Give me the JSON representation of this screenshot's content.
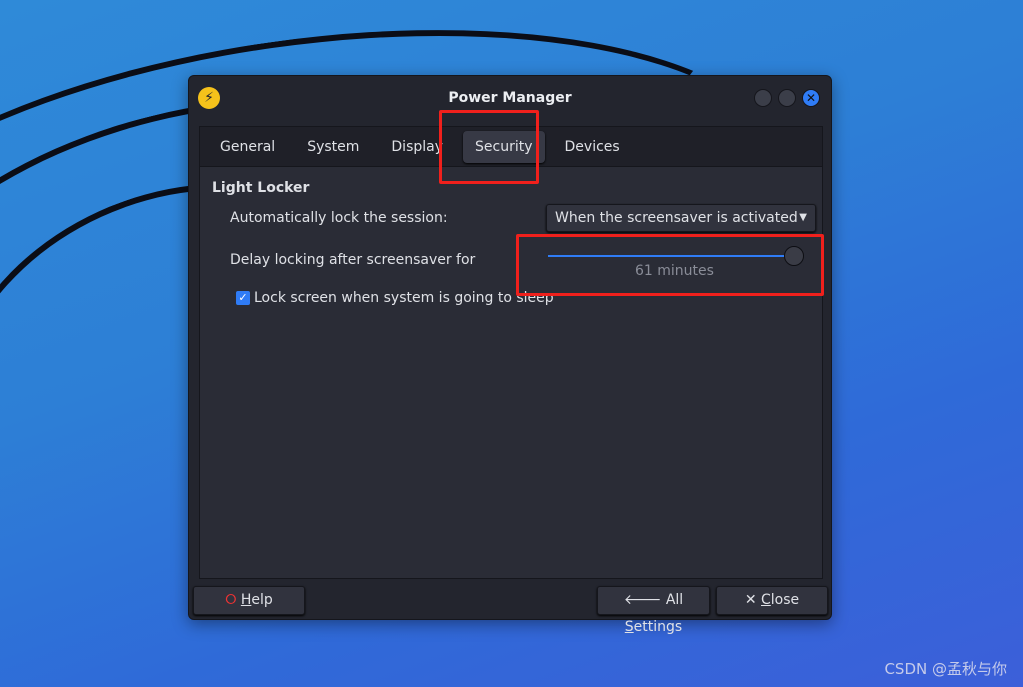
{
  "window": {
    "title": "Power Manager",
    "app_icon": "lightning-icon"
  },
  "tabs": [
    {
      "label": "General"
    },
    {
      "label": "System"
    },
    {
      "label": "Display"
    },
    {
      "label": "Security",
      "active": true
    },
    {
      "label": "Devices"
    }
  ],
  "security": {
    "section_title": "Light Locker",
    "auto_lock_label": "Automatically lock the session:",
    "auto_lock_value": "When the screensaver is activated",
    "delay_label": "Delay locking after screensaver for",
    "delay_value_text": "61 minutes",
    "delay_slider_fraction": 1.0,
    "sleep_lock_label": "Lock screen when system is going to sleep",
    "sleep_lock_checked": true
  },
  "buttons": {
    "help": {
      "mnemonic": "H",
      "rest": "elp",
      "icon": "lifebuoy-icon"
    },
    "all_settings": {
      "prefix": "All ",
      "mnemonic": "S",
      "rest": "ettings",
      "icon": "arrow-left-icon"
    },
    "close": {
      "mnemonic": "C",
      "rest": "lose",
      "icon": "close-icon"
    }
  },
  "watermark": "CSDN @孟秋与你",
  "colors": {
    "accent": "#2f7cf6",
    "highlight": "#f0201c",
    "app_icon": "#f5c21b"
  }
}
